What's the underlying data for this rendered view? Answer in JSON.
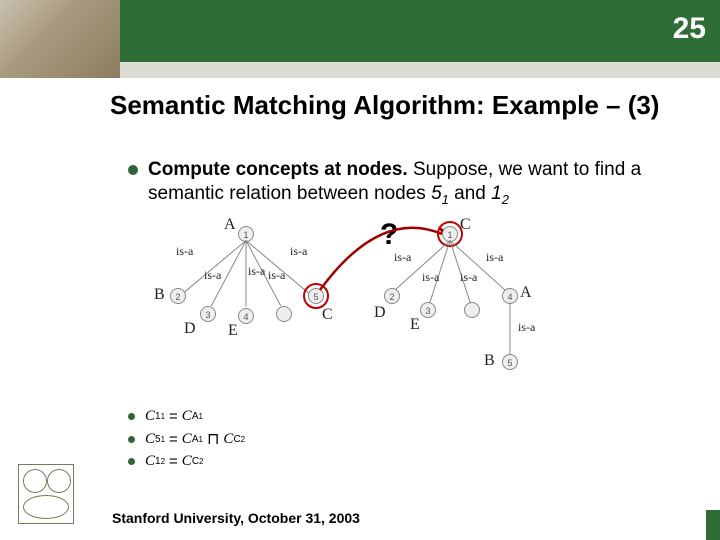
{
  "page_number": "25",
  "title": "Semantic Matching Algorithm: Example – (3)",
  "bullet": {
    "lead": "Compute concepts at nodes. ",
    "tail1": "Suppose, we want to find a semantic relation between nodes ",
    "n1": "5",
    "s1": "1",
    "mid": " and ",
    "n2": "1",
    "s2": "2"
  },
  "diagram": {
    "qmark": "?",
    "left": {
      "root": {
        "id": "1",
        "label": "A"
      },
      "children": [
        {
          "id": "2",
          "label": "B"
        },
        {
          "id": "3",
          "label": "D"
        },
        {
          "id": "4",
          "label": "E"
        },
        {
          "id": "5",
          "label": "C"
        }
      ]
    },
    "right": {
      "root": {
        "id": "1",
        "label": "C"
      },
      "children": [
        {
          "id": "2",
          "label": "D"
        },
        {
          "id": "3",
          "label": "E"
        },
        {
          "id": "4",
          "label": "A"
        }
      ],
      "grandchild": {
        "id": "5",
        "label": "B"
      }
    },
    "edge_label": "is-a"
  },
  "formulas": [
    {
      "lhs_c": "C",
      "lhs_i": "1",
      "lhs_j": "1",
      "rhs": [
        {
          "c": "C",
          "l": "A",
          "i": "1"
        }
      ]
    },
    {
      "lhs_c": "C",
      "lhs_i": "5",
      "lhs_j": "1",
      "rhs": [
        {
          "c": "C",
          "l": "A",
          "i": "1"
        },
        {
          "op": "⊓"
        },
        {
          "c": "C",
          "l": "C",
          "i": "2"
        }
      ]
    },
    {
      "lhs_c": "C",
      "lhs_i": "1",
      "lhs_j": "2",
      "rhs": [
        {
          "c": "C",
          "l": "C",
          "i": "2"
        }
      ]
    }
  ],
  "footer": "Stanford University, October 31, 2003"
}
